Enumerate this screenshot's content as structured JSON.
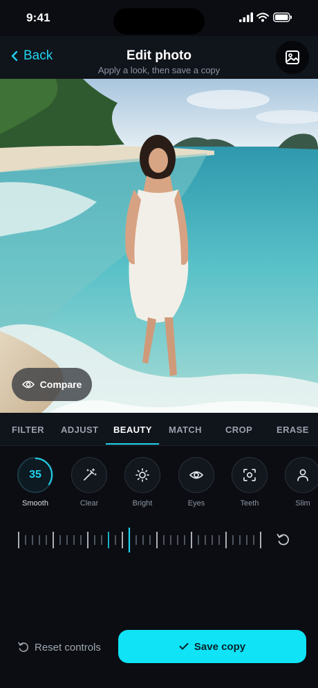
{
  "status_bar": {
    "time": "9:41"
  },
  "header": {
    "back_label": "Back",
    "title": "Edit photo",
    "subtitle": "Apply a look, then save a copy"
  },
  "photo": {
    "compare_label": "Compare"
  },
  "tabs": [
    {
      "label": "FILTER"
    },
    {
      "label": "ADJUST"
    },
    {
      "label": "BEAUTY",
      "active": true
    },
    {
      "label": "MATCH"
    },
    {
      "label": "CROP"
    },
    {
      "label": "ERASE"
    }
  ],
  "tools": [
    {
      "label": "Smooth",
      "icon": "value-ring",
      "value": "35",
      "active": true
    },
    {
      "label": "Clear",
      "icon": "magic-wand-icon"
    },
    {
      "label": "Bright",
      "icon": "sun-icon"
    },
    {
      "label": "Eyes",
      "icon": "eye-icon"
    },
    {
      "label": "Teeth",
      "icon": "face-scan-icon"
    },
    {
      "label": "Slim",
      "icon": "person-icon"
    }
  ],
  "smooth_level": 35,
  "footer": {
    "reset_label": "Reset controls",
    "save_label": "Save copy"
  },
  "colors": {
    "accent": "#1fd3ee",
    "save_button": "#0fe3f5",
    "background": "#0b0d12"
  }
}
